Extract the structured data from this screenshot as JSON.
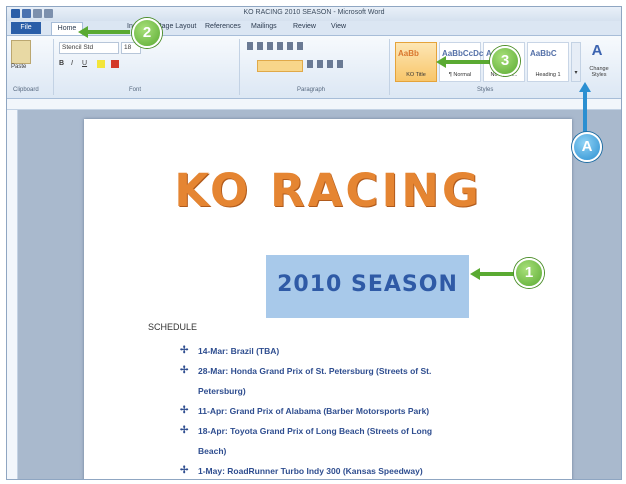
{
  "window": {
    "title": "KO RACING 2010 SEASON - Microsoft Word",
    "file_tab": "File",
    "tabs": [
      "Home",
      "Insert",
      "Page Layout",
      "References",
      "Mailings",
      "Review",
      "View"
    ]
  },
  "ribbon": {
    "clipboard": {
      "paste_label": "Paste",
      "group_label": "Clipboard"
    },
    "font": {
      "name": "Stencil Std",
      "size": "18",
      "group_label": "Font"
    },
    "paragraph": {
      "group_label": "Paragraph"
    },
    "styles": {
      "group_label": "Styles",
      "items": [
        {
          "sample": "AaBb",
          "name": "KO Title"
        },
        {
          "sample": "AaBbCcDc",
          "name": "¶ Normal"
        },
        {
          "sample": "AaBbCc",
          "name": "No Spaci..."
        },
        {
          "sample": "AaBbC",
          "name": "Heading 1"
        }
      ],
      "change_styles": "Change Styles"
    }
  },
  "document": {
    "title": "KO RACING",
    "season": "2010 SEASON",
    "schedule_label": "SCHEDULE",
    "schedule": [
      "14-Mar: Brazil (TBA)",
      "28-Mar: Honda Grand Prix of St. Petersburg (Streets of St.",
      "Petersburg)",
      "11-Apr: Grand Prix of Alabama (Barber Motorsports Park)",
      "18-Apr: Toyota Grand Prix of Long Beach (Streets of Long",
      "Beach)",
      "1-May: RoadRunner Turbo Indy 300 (Kansas Speedway)"
    ]
  },
  "callouts": {
    "c1": "1",
    "c2": "2",
    "c3": "3",
    "cA": "A"
  },
  "colors": {
    "title_orange": "#e58532",
    "season_blue": "#2f5aa6",
    "highlight": "#a8c9ea",
    "callout_green": "#5aaa32",
    "callout_blue": "#2b8fd1"
  }
}
